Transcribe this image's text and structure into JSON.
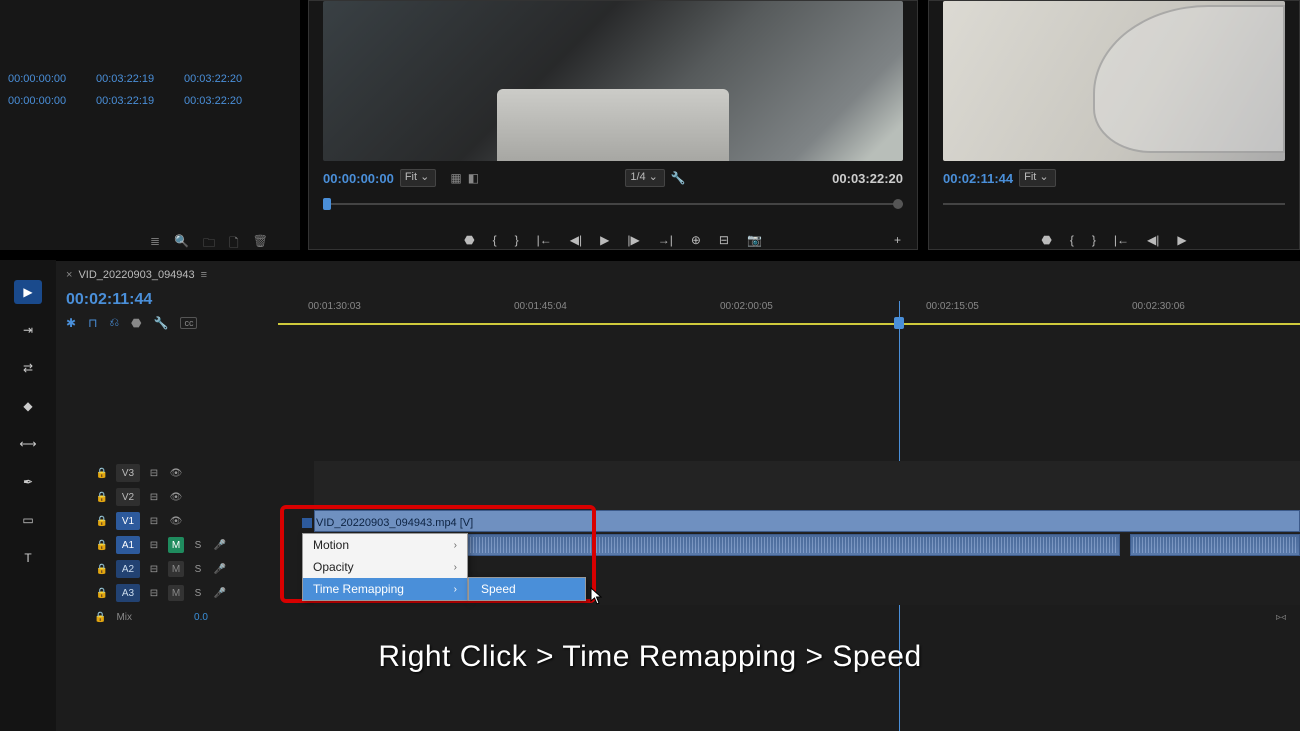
{
  "project": {
    "tc_rows": [
      [
        "00:00:00:00",
        "00:03:22:19",
        "00:03:22:20"
      ],
      [
        "00:00:00:00",
        "00:03:22:19",
        "00:03:22:20"
      ]
    ],
    "icons": [
      "list-icon",
      "search-icon",
      "folder-icon",
      "new-bin-icon",
      "trash-icon"
    ]
  },
  "source": {
    "tc_left": "00:00:00:00",
    "fit": "Fit",
    "zoom": "1/4",
    "tc_right": "00:03:22:20"
  },
  "program": {
    "tc_left": "00:02:11:44",
    "fit": "Fit"
  },
  "sequence": {
    "name": "VID_20220903_094943",
    "playhead_tc": "00:02:11:44",
    "ruler_ticks": [
      "00:01:30:03",
      "00:01:45:04",
      "00:02:00:05",
      "00:02:15:05",
      "00:02:30:06"
    ],
    "clip_name": "VID_20220903_094943.mp4 [V]",
    "tracks": {
      "v3": "V3",
      "v2": "V2",
      "v1": "V1",
      "a1": "A1",
      "a2": "A2",
      "a3": "A3",
      "mix": "Mix",
      "mix_val": "0.0",
      "m": "M",
      "s": "S"
    }
  },
  "context_menu": {
    "items": [
      "Motion",
      "Opacity",
      "Time Remapping"
    ],
    "submenu": "Speed"
  },
  "caption": "Right Click > Time Remapping > Speed",
  "transport": {
    "mark_in": "{",
    "mark_out": "}",
    "go_in": "|←",
    "step_back": "◀|",
    "play": "▶",
    "step_fwd": "|▶",
    "go_out": "→|",
    "lift": "⊟",
    "extract": "⊡",
    "snapshot": "📷",
    "add": "+",
    "marker": "⬣"
  }
}
